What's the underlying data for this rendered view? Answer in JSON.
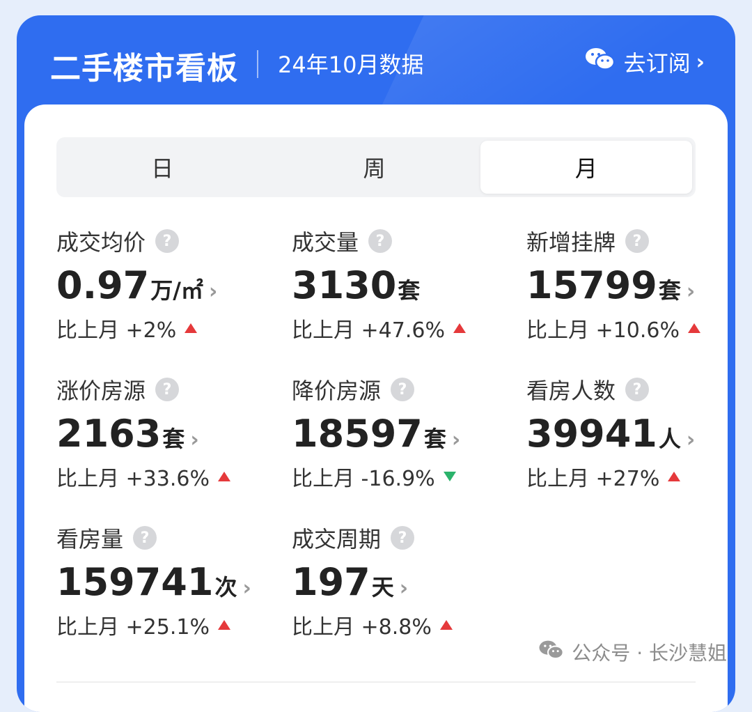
{
  "header": {
    "title": "二手楼市看板",
    "subtitle": "24年10月数据",
    "subscribe_label": "去订阅",
    "subscribe_icon": "wechat-icon"
  },
  "tabs": [
    {
      "label": "日",
      "active": false
    },
    {
      "label": "周",
      "active": false
    },
    {
      "label": "月",
      "active": true
    }
  ],
  "metrics": [
    {
      "label": "成交均价",
      "value": "0.97",
      "unit": "万/㎡",
      "change_label": "比上月 +2%",
      "direction": "up"
    },
    {
      "label": "成交量",
      "value": "3130",
      "unit": "套",
      "change_label": "比上月 +47.6%",
      "direction": "up"
    },
    {
      "label": "新增挂牌",
      "value": "15799",
      "unit": "套",
      "change_label": "比上月 +10.6%",
      "direction": "up"
    },
    {
      "label": "涨价房源",
      "value": "2163",
      "unit": "套",
      "change_label": "比上月 +33.6%",
      "direction": "up"
    },
    {
      "label": "降价房源",
      "value": "18597",
      "unit": "套",
      "change_label": "比上月 -16.9%",
      "direction": "down"
    },
    {
      "label": "看房人数",
      "value": "39941",
      "unit": "人",
      "change_label": "比上月 +27%",
      "direction": "up"
    },
    {
      "label": "看房量",
      "value": "159741",
      "unit": "次",
      "change_label": "比上月 +25.1%",
      "direction": "up"
    },
    {
      "label": "成交周期",
      "value": "197",
      "unit": "天",
      "change_label": "比上月 +8.8%",
      "direction": "up"
    }
  ],
  "watermark": "公众号 · 长沙慧姐",
  "colors": {
    "brand": "#2f6df0",
    "up": "#e5393b",
    "down": "#2bb36b"
  }
}
